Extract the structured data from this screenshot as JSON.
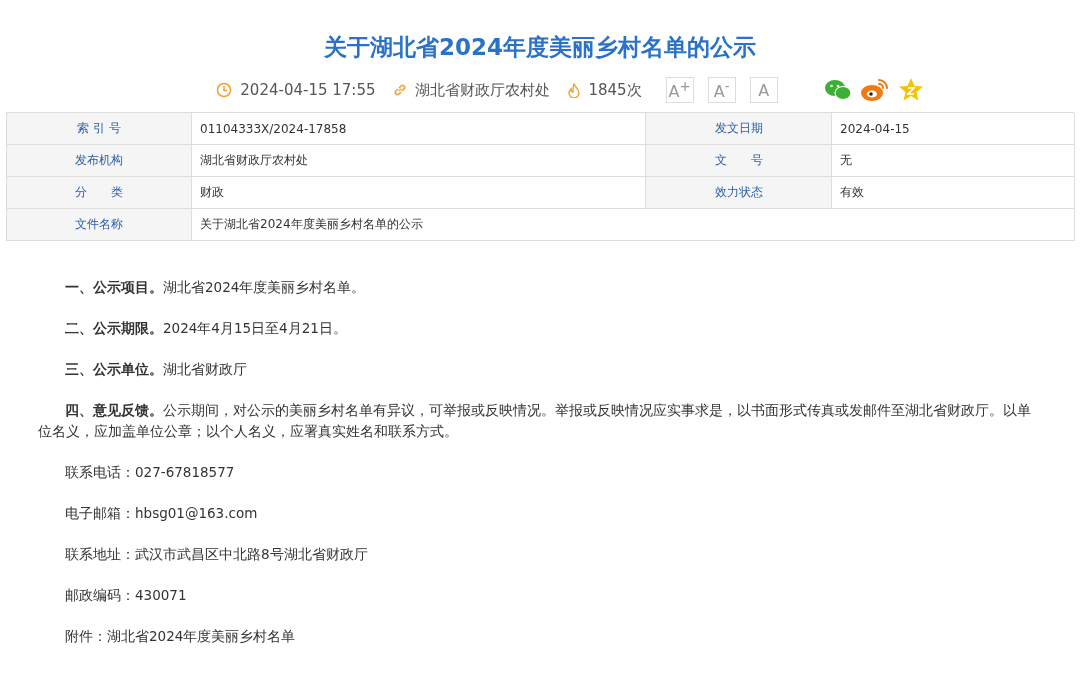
{
  "title": "关于湖北省2024年度美丽乡村名单的公示",
  "meta": {
    "datetime": "2024-04-15 17:55",
    "source": "湖北省财政厅农村处",
    "views": "1845次"
  },
  "font_buttons": [
    "A$^{+}$",
    "A$^{-}$",
    "A"
  ],
  "info_table": [
    {
      "cells": [
        {
          "label": "索 引 号",
          "value": "01104333X/2024-17858"
        },
        {
          "label": "发文日期",
          "value": "2024-04-15"
        }
      ]
    },
    {
      "cells": [
        {
          "label": "发布机构",
          "value": "湖北省财政厅农村处"
        },
        {
          "label": "文　　号",
          "value": "无"
        }
      ]
    },
    {
      "cells": [
        {
          "label": "分　　类",
          "value": "财政"
        },
        {
          "label": "效力状态",
          "value": "有效"
        }
      ]
    },
    {
      "cells": [
        {
          "label": "文件名称",
          "value": "关于湖北省2024年度美丽乡村名单的公示"
        }
      ]
    }
  ],
  "paragraphs": [
    "**一、公示项目。**湖北省2024年度美丽乡村名单。",
    "**二、公示期限。**2024年4月15日至4月21日。",
    "**三、公示单位。**湖北省财政厅",
    "**四、意见反馈。**公示期间，对公示的美丽乡村名单有异议，可举报或反映情况。举报或反映情况应实事求是，以书面形式传真或发邮件至湖北省财政厅。以单位名义，应加盖单位公章；以个人名义，应署真实姓名和联系方式。",
    "联系电话：027-67818577",
    "电子邮箱：hbsg01@163.com",
    "联系地址：武汉市武昌区中北路8号湖北省财政厅",
    "邮政编码：430071",
    "附件：湖北省2024年度美丽乡村名单"
  ]
}
